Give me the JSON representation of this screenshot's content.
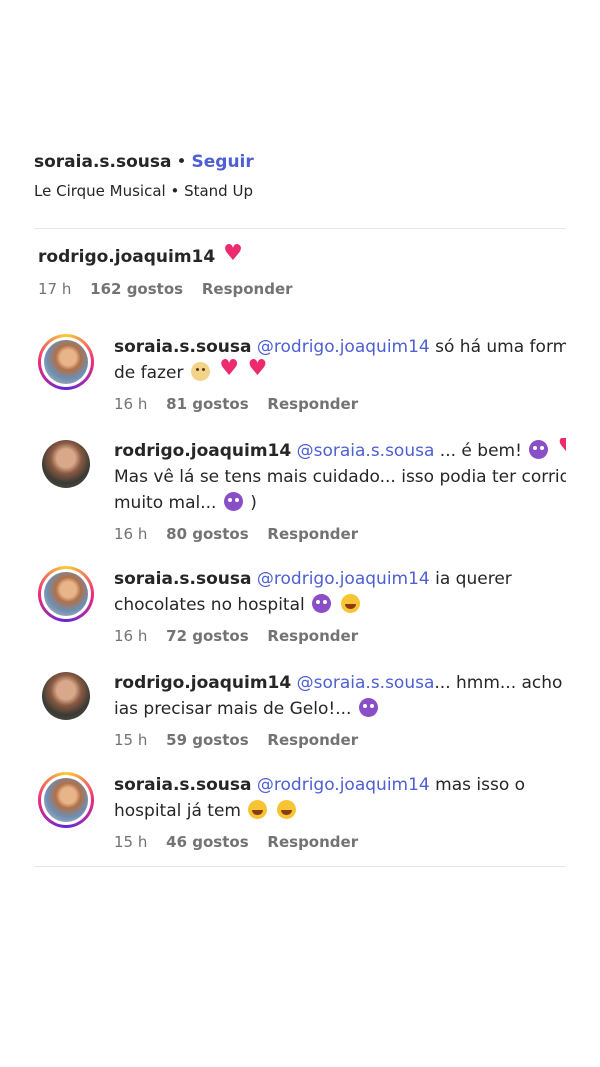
{
  "post": {
    "username": "soraia.s.sousa",
    "separator": "•",
    "follow_label": "Seguir",
    "subtitle": "Le Cirque Musical • Stand Up"
  },
  "caption": {
    "username": "rodrigo.joaquim14",
    "time": "17 h",
    "likes": "162 gostos",
    "reply_label": "Responder"
  },
  "comments": [
    {
      "username": "soraia.s.sousa",
      "mention": "@rodrigo.joaquim14",
      "line1": "só há uma forma",
      "line2": "de fazer",
      "time": "16 h",
      "likes": "81 gostos",
      "reply_label": "Responder"
    },
    {
      "username": "rodrigo.joaquim14",
      "mention": "@soraia.s.sousa",
      "line1": "... é bem!",
      "line2": "Mas vê lá se tens mais cuidado... isso podia ter corrido",
      "line3a": "muito mal...",
      "line3b": ")",
      "time": "16 h",
      "likes": "80 gostos",
      "reply_label": "Responder"
    },
    {
      "username": "soraia.s.sousa",
      "mention": "@rodrigo.joaquim14",
      "line1": "ia querer",
      "line2": "chocolates no hospital",
      "time": "16 h",
      "likes": "72 gostos",
      "reply_label": "Responder"
    },
    {
      "username": "rodrigo.joaquim14",
      "mention": "@soraia.s.sousa",
      "line1": "... hmm... acho que",
      "line2": "ias precisar mais de Gelo!...",
      "time": "15 h",
      "likes": "59 gostos",
      "reply_label": "Responder"
    },
    {
      "username": "soraia.s.sousa",
      "mention": "@rodrigo.joaquim14",
      "line1": "mas isso o",
      "line2": "hospital já tem",
      "time": "15 h",
      "likes": "46 gostos",
      "reply_label": "Responder"
    }
  ],
  "colors": {
    "link": "#4e5fd3",
    "muted": "#737373",
    "heart": "#ee2a6e",
    "devil": "#8a4fc7"
  },
  "icons": [
    "heart-emoji-icon",
    "devil-emoji-icon",
    "laughing-emoji-icon",
    "face-emoji-icon"
  ]
}
